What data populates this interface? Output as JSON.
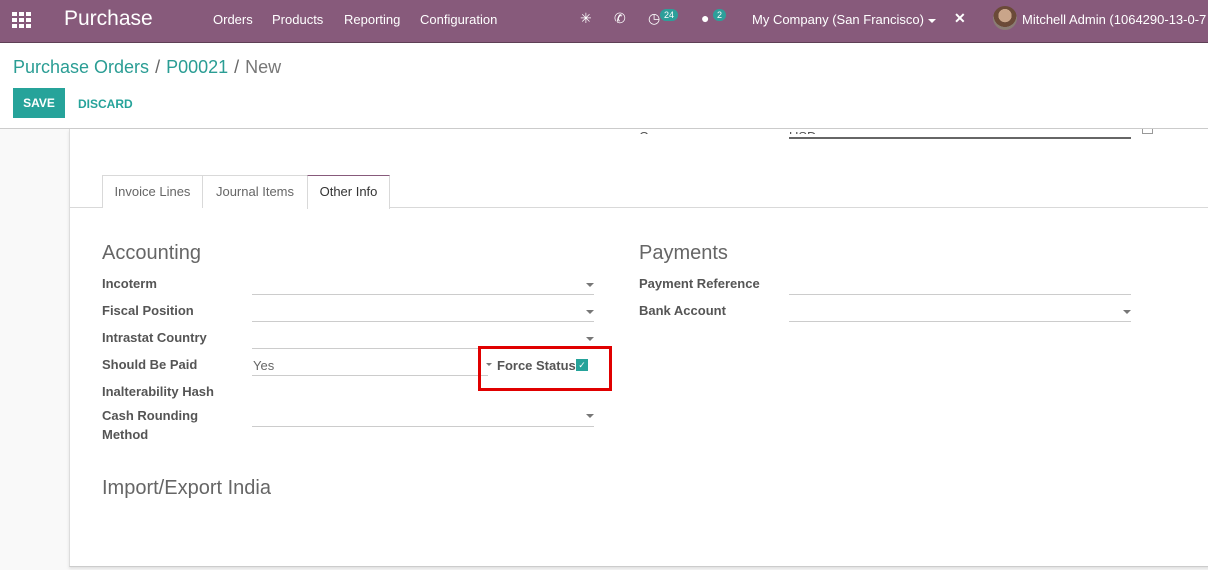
{
  "navbar": {
    "app_name": "Purchase",
    "menu": [
      "Orders",
      "Products",
      "Reporting",
      "Configuration"
    ],
    "activity_count": "24",
    "messages_count": "2",
    "company": "My Company (San Francisco)",
    "user": "Mitchell Admin (1064290-13-0-7"
  },
  "breadcrumb": {
    "items": [
      "Purchase Orders",
      "P00021"
    ],
    "current": "New",
    "separator": "/"
  },
  "buttons": {
    "save": "SAVE",
    "discard": "DISCARD"
  },
  "top_partial": {
    "currency_label": "Currency",
    "currency_value": "USD"
  },
  "tabs": [
    {
      "label": "Invoice Lines",
      "active": false
    },
    {
      "label": "Journal Items",
      "active": false
    },
    {
      "label": "Other Info",
      "active": true
    }
  ],
  "accounting": {
    "title": "Accounting",
    "incoterm": {
      "label": "Incoterm",
      "value": ""
    },
    "fiscal_position": {
      "label": "Fiscal Position",
      "value": ""
    },
    "intrastat_country": {
      "label": "Intrastat Country",
      "value": ""
    },
    "should_be_paid": {
      "label": "Should Be Paid",
      "value": "Yes"
    },
    "force_status": {
      "label": "Force Status",
      "checked": true
    },
    "inalterability_hash": {
      "label": "Inalterability Hash",
      "value": ""
    },
    "cash_rounding_line1": "Cash Rounding",
    "cash_rounding_line2": "Method"
  },
  "payments": {
    "title": "Payments",
    "payment_reference": {
      "label": "Payment Reference",
      "value": ""
    },
    "bank_account": {
      "label": "Bank Account",
      "value": ""
    }
  },
  "import_export": {
    "title": "Import/Export India"
  },
  "highlight_color": "#e00000",
  "accent_color": "#26a39a",
  "brand_color": "#875a7b"
}
